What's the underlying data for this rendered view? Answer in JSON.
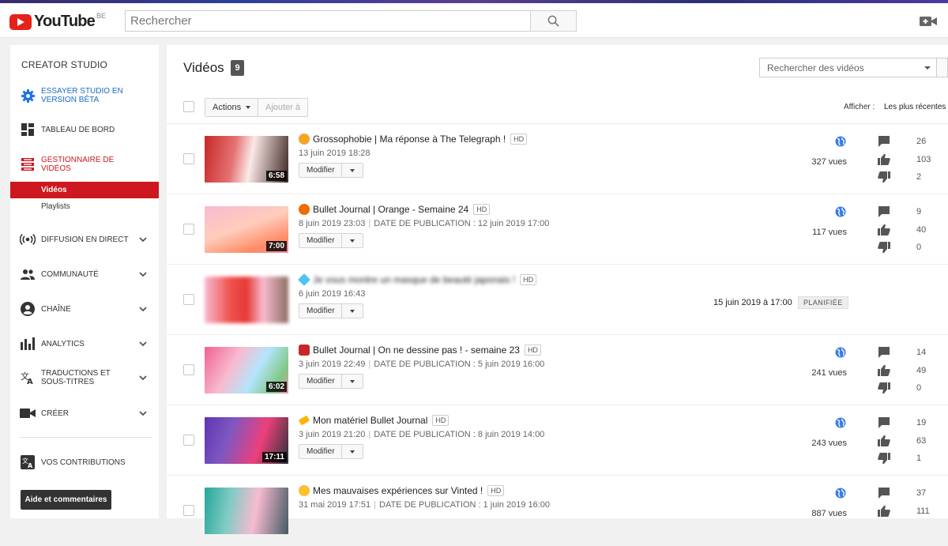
{
  "masthead": {
    "logo_text": "YouTube",
    "country_code": "BE",
    "search_placeholder": "Rechercher"
  },
  "sidebar": {
    "title": "CREATOR STUDIO",
    "items": [
      {
        "label": "ESSAYER STUDIO EN VERSION BÊTA",
        "icon": "gear-icon",
        "active": true
      },
      {
        "label": "TABLEAU DE BORD",
        "icon": "dashboard-icon"
      },
      {
        "label": "GESTIONNAIRE DE VIDÉOS",
        "icon": "video-manager-icon",
        "active": true
      },
      {
        "label": "DIFFUSION EN DIRECT",
        "icon": "live-icon"
      },
      {
        "label": "COMMUNAUTÉ",
        "icon": "people-icon"
      },
      {
        "label": "CHAÎNE",
        "icon": "account-icon"
      },
      {
        "label": "ANALYTICS",
        "icon": "analytics-icon"
      },
      {
        "label": "TRADUCTIONS ET SOUS-TITRES",
        "icon": "translate-icon"
      },
      {
        "label": "CRÉER",
        "icon": "camera-icon"
      },
      {
        "label": "VOS CONTRIBUTIONS",
        "icon": "translate-icon"
      }
    ],
    "sub_items": [
      "Vidéos",
      "Playlists"
    ],
    "help_button": "Aide et commentaires"
  },
  "main": {
    "title": "Vidéos",
    "count": "9",
    "search_placeholder": "Rechercher des vidéos",
    "actions_label": "Actions",
    "add_to_label": "Ajouter à",
    "sort_label": "Afficher :",
    "sort_value": "Les plus récentes",
    "edit_label": "Modifier"
  },
  "videos": [
    {
      "title": "Grossophobie | Ma réponse à The Telegraph !",
      "hd": "HD",
      "date": "13 juin 2019 18:28",
      "publish": "",
      "duration": "6:58",
      "views": "327 vues",
      "comments": "26",
      "likes": "103",
      "dislikes": "2",
      "emoji_color": "#f5a623",
      "thumb": [
        "#c62828",
        "#f8bbd0",
        "#37474f"
      ]
    },
    {
      "title": "Bullet Journal | Orange - Semaine 24",
      "hd": "HD",
      "date": "8 juin 2019 23:03",
      "publish": "DATE DE PUBLICATION : 12 juin 2019 17:00",
      "duration": "7:00",
      "views": "117 vues",
      "comments": "9",
      "likes": "40",
      "dislikes": "0",
      "emoji_color": "#ef6c00",
      "thumb": [
        "#f48fb1",
        "#ffccbc",
        "#ff8a65"
      ]
    },
    {
      "title": "Je vous montre un masque de beauté japonais !",
      "hd": "HD",
      "date": "6 juin 2019 16:43",
      "publish": "",
      "scheduled_date": "15 juin 2019 à 17:00",
      "scheduled_label": "PLANIFIÉE",
      "emoji_color": "#4fc3f7",
      "thumb": [
        "#ef5350",
        "#f8bbd0",
        "#8d6e63"
      ]
    },
    {
      "title": "Bullet Journal | On ne dessine pas ! - semaine 23",
      "hd": "HD",
      "date": "3 juin 2019 22:49",
      "publish": "DATE DE PUBLICATION : 5 juin 2019 16:00",
      "duration": "6:02",
      "views": "241 vues",
      "comments": "14",
      "likes": "49",
      "dislikes": "0",
      "emoji_color": "#c62828",
      "thumb": [
        "#f06292",
        "#b3e5fc",
        "#81c784"
      ]
    },
    {
      "title": "Mon matériel Bullet Journal",
      "hd": "HD",
      "date": "3 juin 2019 21:20",
      "publish": "DATE DE PUBLICATION : 8 juin 2019 14:00",
      "duration": "17:11",
      "views": "243 vues",
      "comments": "19",
      "likes": "63",
      "dislikes": "1",
      "emoji_color": "#ffb300",
      "thumb": [
        "#7e57c2",
        "#ec407a",
        "#37474f"
      ]
    },
    {
      "title": "Mes mauvaises expériences sur Vinted !",
      "hd": "HD",
      "date": "31 mai 2019 17:51",
      "publish": "DATE DE PUBLICATION : 1 juin 2019 16:00",
      "duration": "",
      "views": "887 vues",
      "comments": "37",
      "likes": "111",
      "dislikes": "",
      "emoji_color": "#fbc02d",
      "thumb": [
        "#26a69a",
        "#f8bbd0",
        "#455a64"
      ]
    }
  ]
}
